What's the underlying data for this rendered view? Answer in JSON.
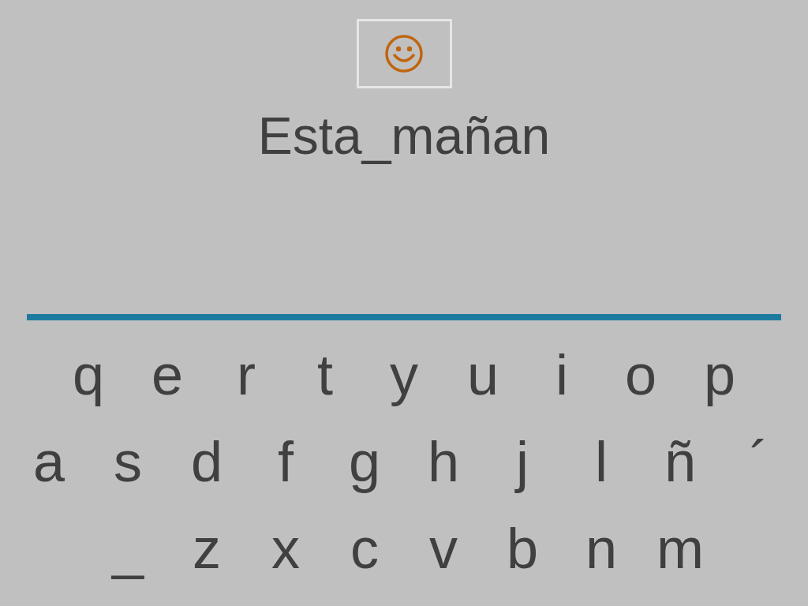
{
  "phrase": "Esta_mañan",
  "keyboard": [
    [
      "q",
      "e",
      "r",
      "t",
      "y",
      "u",
      "i",
      "o",
      "p"
    ],
    [
      "a",
      "s",
      "d",
      "f",
      "g",
      "h",
      "j",
      "l",
      "ñ",
      "´"
    ],
    [
      "_",
      "z",
      "x",
      "c",
      "v",
      "b",
      "n",
      "m"
    ]
  ]
}
